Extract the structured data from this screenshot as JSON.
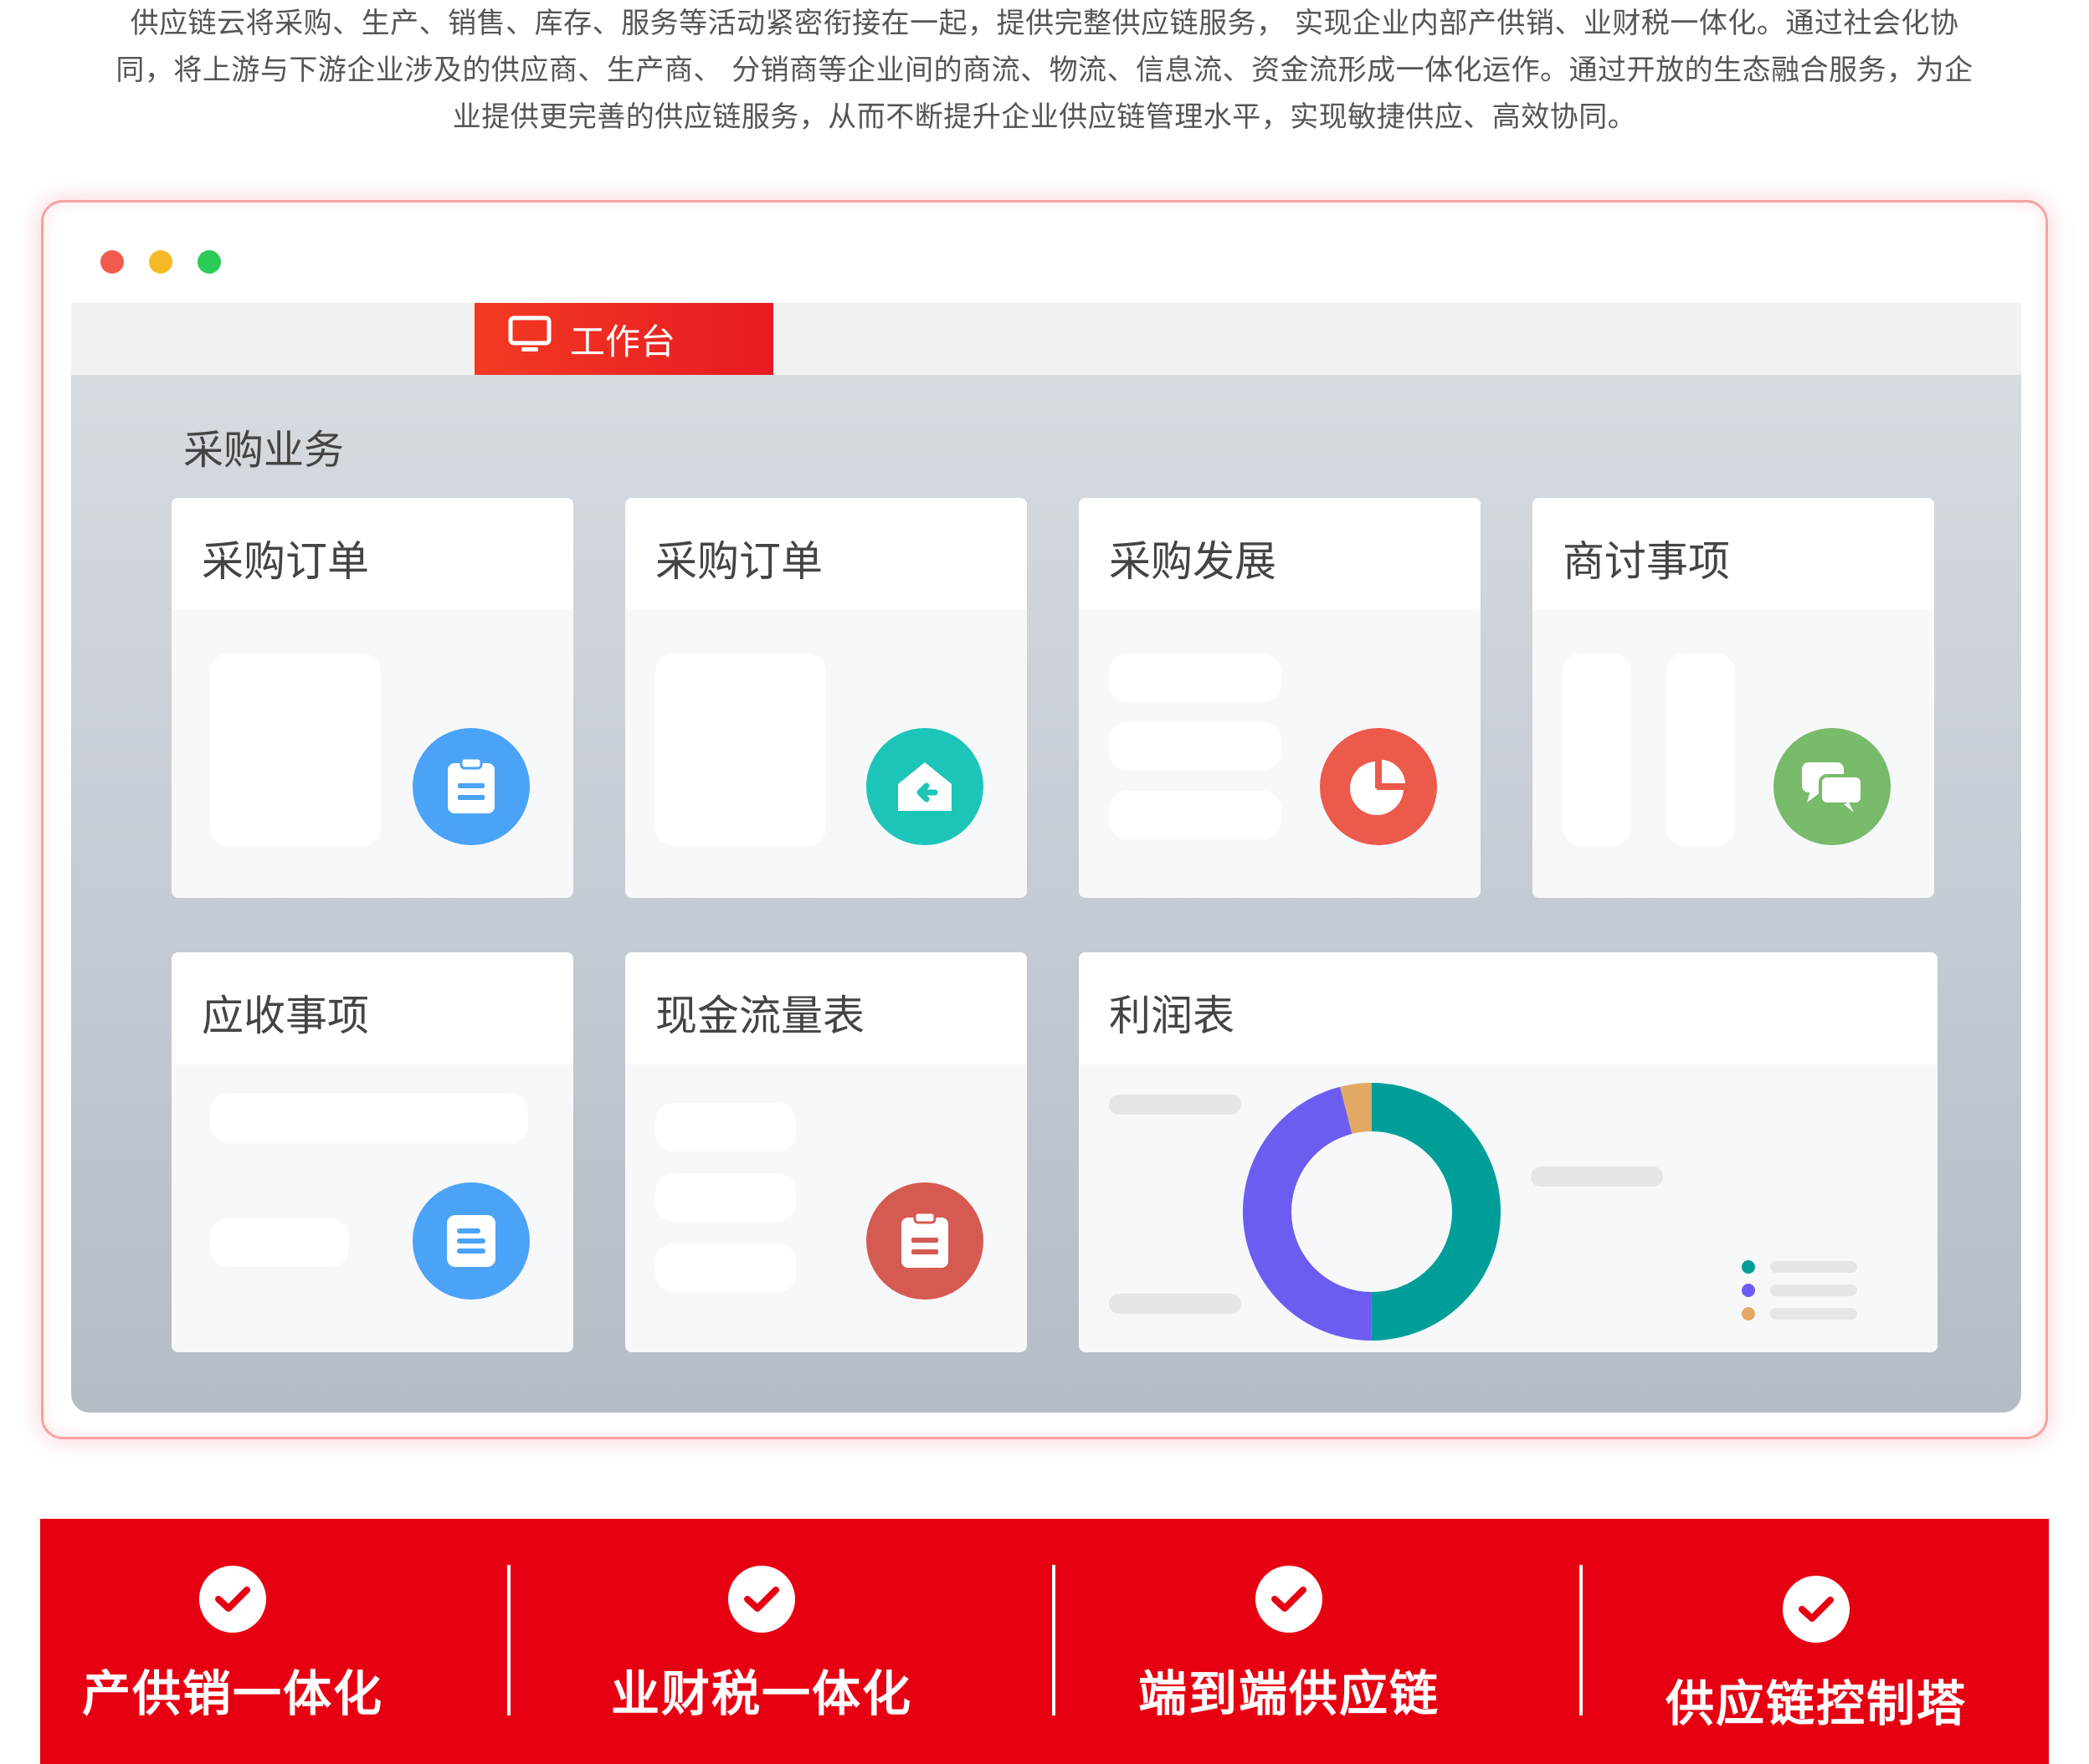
{
  "intro": {
    "line1": "供应链云将采购、生产、销售、库存、服务等活动紧密衔接在一起，提供完整供应链服务， 实现企业内部产供销、业财税一体化。通过社会化协",
    "line2": "同，将上游与下游企业涉及的供应商、生产商、 分销商等企业间的商流、物流、信息流、资金流形成一体化运作。通过开放的生态融合服务，为企",
    "line3": "业提供更完善的供应链服务，从而不断提升企业供应链管理水平，实现敏捷供应、高效协同。"
  },
  "window": {
    "dot_colors": [
      "#f25a4e",
      "#f7b925",
      "#2ccb55"
    ],
    "active_tab": {
      "label": "工作台",
      "icon": "monitor-icon"
    }
  },
  "workspace": {
    "section_title": "采购业务",
    "cards": [
      {
        "title": "采购订单",
        "icon": "clipboard-icon",
        "color": "#4aa3f7"
      },
      {
        "title": "采购订单",
        "icon": "home-return-icon",
        "color": "#1cc5b8"
      },
      {
        "title": "采购发展",
        "icon": "pie-chart-icon",
        "color": "#ec5a4c"
      },
      {
        "title": "商讨事项",
        "icon": "chat-bubbles-icon",
        "color": "#78bb6b"
      },
      {
        "title": "应收事项",
        "icon": "document-icon",
        "color": "#4aa3f7"
      },
      {
        "title": "现金流量表",
        "icon": "clipboard-icon",
        "color": "#d55b52"
      },
      {
        "title": "利润表",
        "icon": "donut-chart-icon",
        "color": "#009b95"
      }
    ],
    "profit_chart": {
      "type": "pie",
      "values": [
        50,
        46,
        4
      ],
      "colors": [
        "#009e98",
        "#6c5df0",
        "#e3a964"
      ]
    }
  },
  "banner": {
    "features": [
      {
        "label": "产供销一体化"
      },
      {
        "label": "业财税一体化"
      },
      {
        "label": "端到端供应链"
      },
      {
        "label": "供应链控制塔"
      }
    ]
  }
}
